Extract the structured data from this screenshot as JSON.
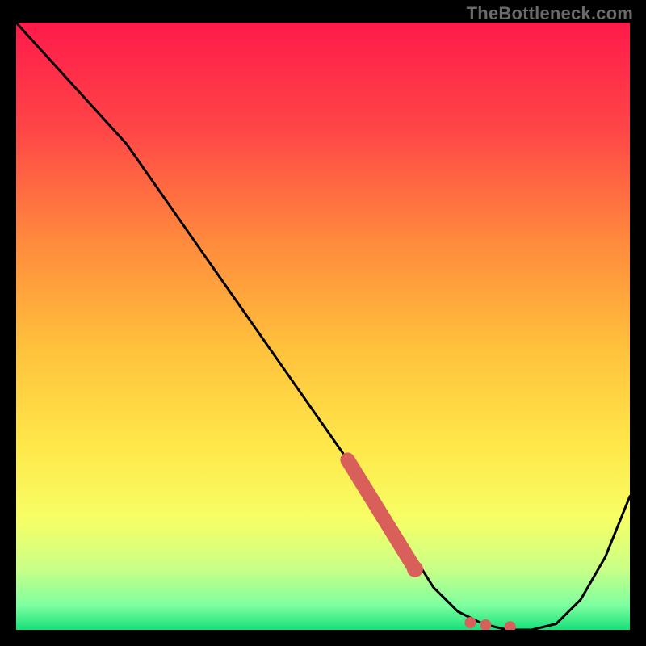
{
  "watermark": "TheBottleneck.com",
  "chart_data": {
    "type": "line",
    "title": "",
    "xlabel": "",
    "ylabel": "",
    "xlim": [
      0,
      100
    ],
    "ylim": [
      0,
      100
    ],
    "series": [
      {
        "name": "curve",
        "x": [
          0,
          9,
          18,
          27,
          36,
          45,
          54,
          63,
          68,
          72,
          76,
          80,
          84,
          88,
          92,
          96,
          100
        ],
        "y": [
          100,
          90,
          80,
          67,
          54,
          41,
          28,
          15,
          7,
          3,
          1,
          0,
          0,
          1,
          5,
          12,
          22
        ]
      }
    ],
    "markers": {
      "name": "dots",
      "x": [
        65,
        74,
        76.5,
        80.5
      ],
      "y": [
        10,
        1.2,
        0.8,
        0.5
      ]
    },
    "thick_segment": {
      "name": "highlight",
      "x": [
        54,
        65
      ],
      "y": [
        28,
        10
      ]
    },
    "gradient_stops": [
      {
        "offset": 0.0,
        "color": "#ff1a4b"
      },
      {
        "offset": 0.18,
        "color": "#ff4747"
      },
      {
        "offset": 0.36,
        "color": "#ff8a3d"
      },
      {
        "offset": 0.54,
        "color": "#ffc23c"
      },
      {
        "offset": 0.7,
        "color": "#ffe84a"
      },
      {
        "offset": 0.82,
        "color": "#f6ff66"
      },
      {
        "offset": 0.9,
        "color": "#c9ff87"
      },
      {
        "offset": 0.96,
        "color": "#7dffa0"
      },
      {
        "offset": 1.0,
        "color": "#16e07a"
      }
    ],
    "line_color": "#000000",
    "marker_color": "#d9605a",
    "highlight_color": "#d9605a"
  }
}
